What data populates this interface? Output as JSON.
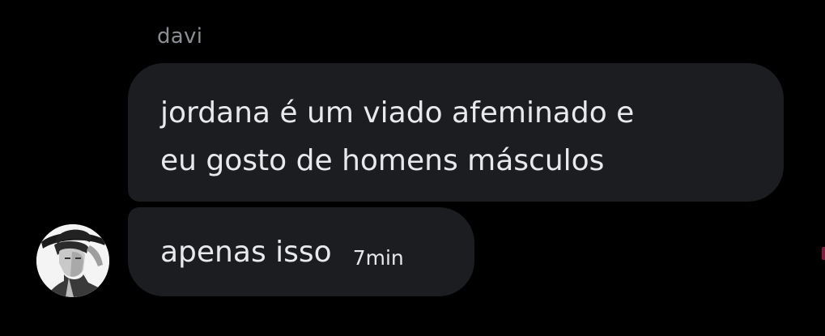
{
  "conversation": {
    "sender_name": "davi",
    "messages": [
      {
        "lines": [
          "jordana é um viado afeminado e",
          "eu gosto de homens másculos"
        ]
      },
      {
        "text": "apenas isso",
        "timestamp": "7min"
      }
    ],
    "avatar_icon": "user-photo-avatar"
  },
  "colors": {
    "background": "#000000",
    "bubble": "#1c1d20",
    "text": "#e7e9ea",
    "sender_name": "#8b8f94"
  }
}
